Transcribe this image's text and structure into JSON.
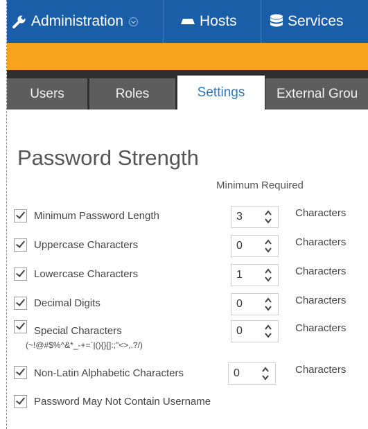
{
  "nav": {
    "items": [
      {
        "label": "Administration",
        "icon": "wrench-icon"
      },
      {
        "label": "Hosts",
        "icon": "server-icon"
      },
      {
        "label": "Services",
        "icon": "database-icon"
      }
    ]
  },
  "tabs": [
    {
      "label": "Users",
      "active": false
    },
    {
      "label": "Roles",
      "active": false
    },
    {
      "label": "Settings",
      "active": true
    },
    {
      "label": "External Grou",
      "active": false
    }
  ],
  "password_strength": {
    "title": "Password Strength",
    "column_header": "Minimum Required",
    "rules": [
      {
        "label": "Minimum Password Length",
        "checked": true,
        "value": "3",
        "unit": "Characters"
      },
      {
        "label": "Uppercase Characters",
        "checked": true,
        "value": "0",
        "unit": "Characters"
      },
      {
        "label": "Lowercase Characters",
        "checked": true,
        "value": "1",
        "unit": "Characters"
      },
      {
        "label": "Decimal Digits",
        "checked": true,
        "value": "0",
        "unit": "Characters"
      },
      {
        "label": "Special Characters",
        "sublabel": "(~!@#$%^&*_-+=`|(){}[]:;\"<>,.?/)",
        "checked": true,
        "value": "0",
        "unit": "Characters"
      },
      {
        "label": "Non-Latin Alphabetic Characters",
        "checked": true,
        "value": "0",
        "unit": "Characters"
      }
    ],
    "username_rule": {
      "label": "Password May Not Contain Username",
      "checked": true
    }
  },
  "colors": {
    "nav_bg": "#1b5ea8",
    "accent_orange": "#f7a41c",
    "tab_strip": "#2e2e2e",
    "tab_inactive": "#5d5d5d",
    "tab_active_text": "#2f79bf"
  }
}
